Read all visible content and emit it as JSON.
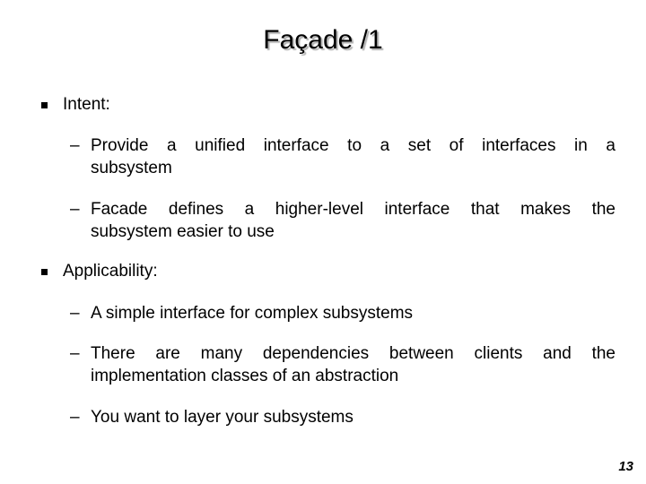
{
  "slide": {
    "title": "Façade /1",
    "page_number": "13",
    "sections": [
      {
        "heading": "Intent:",
        "items": [
          {
            "line1": "Provide a unified interface to a set of interfaces in a",
            "line2": "subsystem"
          },
          {
            "line1": "Facade defines a higher-level interface that makes the",
            "line2": "subsystem easier to use"
          }
        ]
      },
      {
        "heading": "Applicability:",
        "items": [
          {
            "line1": "A simple interface for complex subsystems"
          },
          {
            "line1": "There are many dependencies between clients and the",
            "line2": "implementation classes of an abstraction"
          },
          {
            "line1": "You want to layer your subsystems"
          }
        ]
      }
    ],
    "dash": "–"
  }
}
